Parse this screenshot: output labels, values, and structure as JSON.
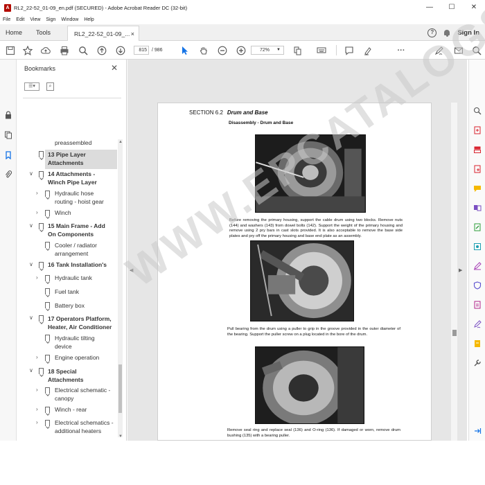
{
  "window": {
    "title": "RL2_22-52_01-09_en.pdf (SECURED) - Adobe Acrobat Reader DC (32-bit)",
    "min": "—",
    "max": "☐",
    "close": "✕"
  },
  "menu": [
    "File",
    "Edit",
    "View",
    "Sign",
    "Window",
    "Help"
  ],
  "tabs": {
    "home": "Home",
    "tools": "Tools",
    "doc": "RL2_22-52_01-09_...",
    "doc_close": "×",
    "signin": "Sign In",
    "help": "?"
  },
  "toolbar": {
    "page_current": "815",
    "page_total": "/ 986",
    "zoom": "72%",
    "more": "···"
  },
  "bookmarks": {
    "title": "Bookmarks",
    "close": "✕",
    "list_icon": "☰▾",
    "items": [
      {
        "label1": "preassembled",
        "label2": ""
      },
      {
        "label1": "13 Pipe Layer",
        "label2": "Attachments"
      },
      {
        "label1": "14 Attachments -",
        "label2": "Winch Pipe Layer"
      },
      {
        "label1": "Hydraulic hose",
        "label2": "routing - hoist gear"
      },
      {
        "label1": "Winch",
        "label2": ""
      },
      {
        "label1": "15 Main Frame - Add",
        "label2": "On Components"
      },
      {
        "label1": "Cooler / radiator",
        "label2": "arrangement"
      },
      {
        "label1": "16 Tank Installation's",
        "label2": ""
      },
      {
        "label1": "Hydraulic tank",
        "label2": ""
      },
      {
        "label1": "Fuel tank",
        "label2": ""
      },
      {
        "label1": "Battery box",
        "label2": ""
      },
      {
        "label1": "17 Operators Platform,",
        "label2": "Heater, Air Conditioner"
      },
      {
        "label1": "Hydraulic tilting",
        "label2": "device"
      },
      {
        "label1": "Engine operation",
        "label2": ""
      },
      {
        "label1": "18 Special",
        "label2": "Attachments"
      },
      {
        "label1": "Electrical schematic -",
        "label2": "canopy"
      },
      {
        "label1": "Winch - rear",
        "label2": ""
      },
      {
        "label1": "Electrical schematics -",
        "label2": "additional heaters"
      }
    ]
  },
  "document": {
    "section": "SECTION 6.2",
    "section_title": "Drum and Base",
    "subhead": "Disassembly - Drum and Base",
    "caption1": "Before removing the primary housing, support the cable drum using two blocks. Remove nuts (144) and washers (143) from dowel bolts (142). Support the weight of the primary housing and remove using 2 pry bars in cast slots provided. It is also acceptable to remove the base side plates and pry off the primary housing and base end plate as an assembly.",
    "caption2": "Pull bearing from the drum using a puller to grip in the groove provided in the outer diameter of the bearing. Support the puller screw on a plug located in the bore of the drum.",
    "caption3": "Remove seal ring and replace seal (136) and O-ring (136). If damaged or worn, remove drum bushing (135) with a bearing puller.",
    "watermark": "WWW.EPCATALOGS.COM"
  },
  "colors": {
    "accent": "#1473e6",
    "brand": "#b30b00"
  }
}
